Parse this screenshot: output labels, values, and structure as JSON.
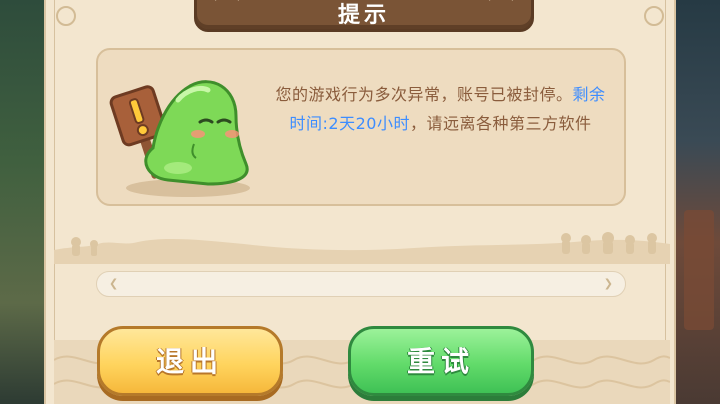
{
  "dialog": {
    "title": "提示",
    "message_before": "您的游戏行为多次异常，账号已被封停。",
    "message_highlight": "剩余时间:2天20小时",
    "message_after": "，请远离各种第三方软件"
  },
  "buttons": {
    "exit_label": "退出",
    "retry_label": "重试"
  },
  "colors": {
    "panel": "#f3e6cf",
    "highlight_text": "#3d8dff",
    "body_text": "#8a5c3c",
    "exit_button": "#ffd45e",
    "retry_button": "#62db6a"
  },
  "icons": {
    "mascot": "green-slime-with-warning-sign-icon"
  }
}
